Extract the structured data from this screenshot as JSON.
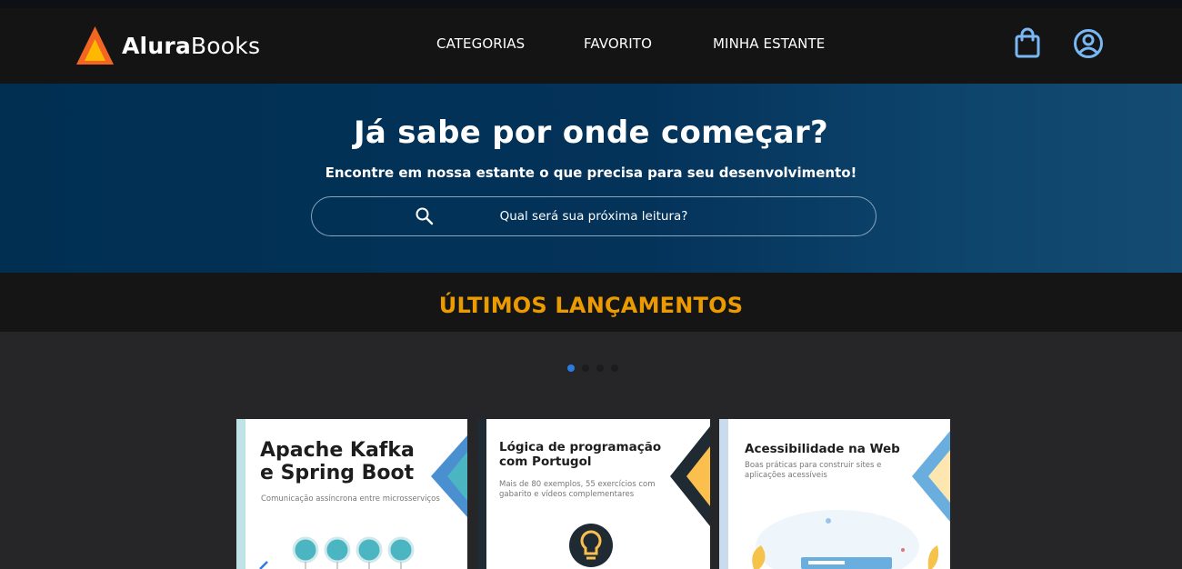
{
  "header": {
    "logo": {
      "part1": "Alura",
      "part2": "Books",
      "brand_colors": [
        "#f26522",
        "#ffb800"
      ]
    },
    "nav": [
      "CATEGORIAS",
      "FAVORITO",
      "MINHA ESTANTE"
    ],
    "icons": [
      "bag-icon",
      "user-icon"
    ]
  },
  "hero": {
    "title": "Já sabe por onde começar?",
    "subtitle": "Encontre em nossa estante o que precisa para seu desenvolvimento!",
    "search_placeholder": "Qual será sua próxima leitura?"
  },
  "section": {
    "title": "ÚLTIMOS LANÇAMENTOS",
    "color": "#eb9b00"
  },
  "carousel": {
    "dots": 4,
    "active_dot": 1
  },
  "books": [
    {
      "title_line1": "Apache Kafka",
      "title_line2": "e Spring Boot",
      "subtitle": "Comunicação assíncrona entre microsserviços",
      "accent": "#4bb5c1"
    },
    {
      "title_line1": "Lógica de programação",
      "title_line2": "com Portugol",
      "subtitle_line1": "Mais de 80 exemplos, 55 exercícios com",
      "subtitle_line2": "gabarito e vídeos complementares",
      "accent": "#fbbf4e"
    },
    {
      "title": "Acessibilidade na Web",
      "subtitle_line1": "Boas práticas para construir sites e",
      "subtitle_line2": "aplicações acessíveis",
      "accent": "#6aaee0"
    }
  ]
}
